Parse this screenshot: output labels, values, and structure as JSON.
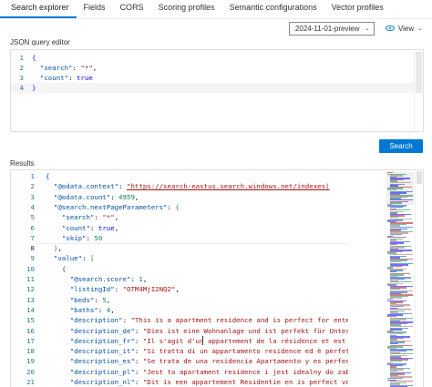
{
  "tabs": [
    {
      "label": "Search explorer",
      "active": true
    },
    {
      "label": "Fields"
    },
    {
      "label": "CORS"
    },
    {
      "label": "Scoring profiles"
    },
    {
      "label": "Semantic configurations"
    },
    {
      "label": "Vector profiles"
    }
  ],
  "toolbar": {
    "api_version": "2024-11-01-preview",
    "view_label": "View"
  },
  "query_editor": {
    "label": "JSON query editor",
    "lines": [
      {
        "n": "1",
        "text": "{"
      },
      {
        "n": "2",
        "text": "  \"search\": \"*\","
      },
      {
        "n": "3",
        "text": "  \"count\": true"
      },
      {
        "n": "4",
        "text": "}"
      }
    ]
  },
  "search_button": "Search",
  "results": {
    "label": "Results",
    "lines": [
      {
        "n": "1",
        "text": "{"
      },
      {
        "n": "2",
        "text": "  \"@odata.context\": \"https://search-eastus.search.windows.net/indexes("
      },
      {
        "n": "3",
        "text": "  \"@odata.count\": 4959,"
      },
      {
        "n": "4",
        "text": "  \"@search.nextPageParameters\": {"
      },
      {
        "n": "5",
        "text": "    \"search\": \"*\","
      },
      {
        "n": "6",
        "text": "    \"count\": true,"
      },
      {
        "n": "7",
        "text": "    \"skip\": 50"
      },
      {
        "n": "8",
        "text": "  },"
      },
      {
        "n": "9",
        "text": "  \"value\": ["
      },
      {
        "n": "10",
        "text": "    {"
      },
      {
        "n": "11",
        "text": "      \"@search.score\": 1,"
      },
      {
        "n": "12",
        "text": "      \"listingId\": \"OTM4MjI2NQ2\","
      },
      {
        "n": "13",
        "text": "      \"beds\": 5,"
      },
      {
        "n": "14",
        "text": "      \"baths\": 4,"
      },
      {
        "n": "15",
        "text": "      \"description\": \"This is a apartment residence and is perfect for entertain"
      },
      {
        "n": "16",
        "text": "      \"description_de\": \"Dies ist eine Wohnanlage und ist perfekt für Unterhaltu"
      },
      {
        "n": "17",
        "text": "      \"description_fr\": \"Il s'agit d'un appartement de la résidence et est parfa"
      },
      {
        "n": "18",
        "text": "      \"description_it\": \"Si tratta di un appartamento residence ed è perfetto pe"
      },
      {
        "n": "19",
        "text": "      \"description_es\": \"Se trata de una residencia Apartamento y es perfecto pa"
      },
      {
        "n": "20",
        "text": "      \"description_pl\": \"Jest to apartament residence i jest idealny do zabawy."
      },
      {
        "n": "21",
        "text": "      \"description_nl\": \"Dit is een appartement Residentie en is perfect voor en"
      }
    ]
  },
  "colors": {
    "accent": "#0078d4",
    "string": "#a31515",
    "key": "#0451a5",
    "number": "#098658",
    "keyword": "#0000ff",
    "line_number": "#237893"
  }
}
